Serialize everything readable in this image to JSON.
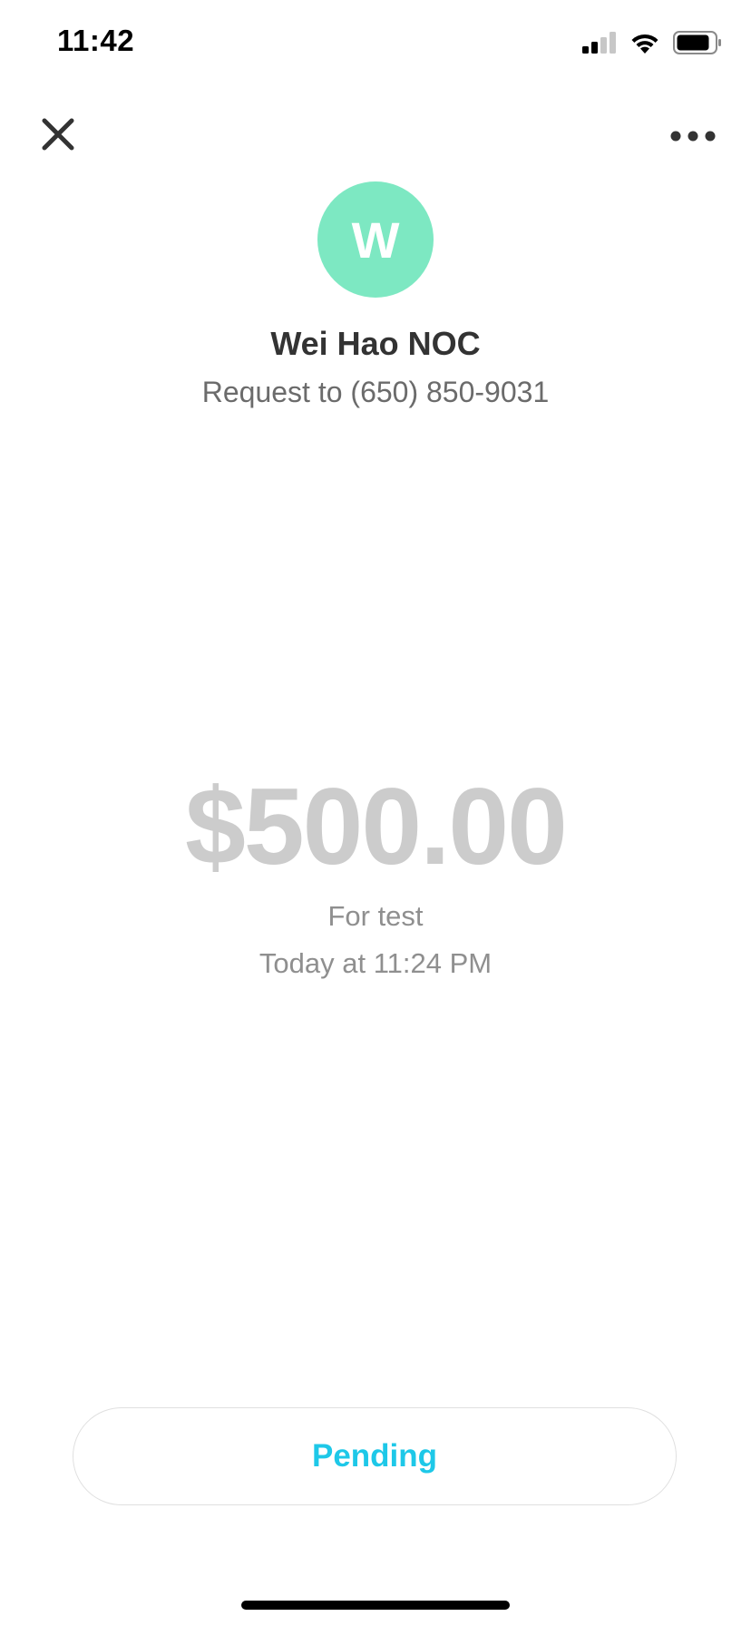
{
  "status_bar": {
    "time": "11:42",
    "icons": [
      "cellular-signal-icon",
      "wifi-icon",
      "battery-icon"
    ]
  },
  "nav": {
    "close_icon": "close-icon",
    "more_icon": "more-options-icon"
  },
  "recipient": {
    "avatar_initial": "W",
    "avatar_color": "#7de8c2",
    "name": "Wei Hao NOC",
    "subtitle": "Request to (650) 850-9031"
  },
  "payment": {
    "amount": "$500.00",
    "note": "For test",
    "timestamp": "Today at 11:24 PM"
  },
  "status_button": {
    "label": "Pending",
    "color": "#1ec8e8"
  }
}
